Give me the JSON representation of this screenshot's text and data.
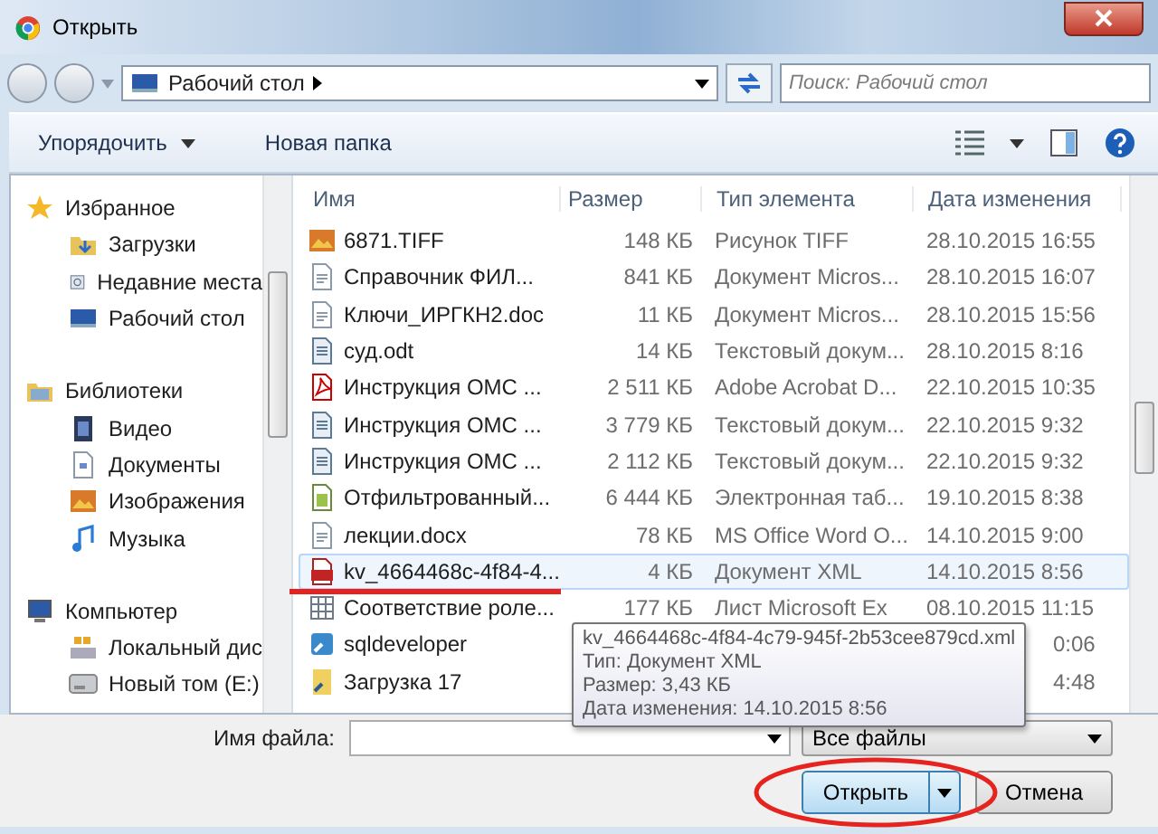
{
  "window": {
    "title": "Открыть"
  },
  "address": {
    "path": "Рабочий стол",
    "search_placeholder": "Поиск: Рабочий стол"
  },
  "toolbar": {
    "organize": "Упорядочить",
    "new_folder": "Новая папка"
  },
  "sidebar": {
    "groups": [
      {
        "label": "Избранное",
        "kind": "star",
        "children": [
          {
            "label": "Загрузки",
            "kind": "download"
          },
          {
            "label": "Недавние места",
            "kind": "recent"
          },
          {
            "label": "Рабочий стол",
            "kind": "desktop"
          }
        ]
      },
      {
        "label": "Библиотеки",
        "kind": "library",
        "children": [
          {
            "label": "Видео",
            "kind": "video"
          },
          {
            "label": "Документы",
            "kind": "document"
          },
          {
            "label": "Изображения",
            "kind": "image"
          },
          {
            "label": "Музыка",
            "kind": "music"
          }
        ]
      },
      {
        "label": "Компьютер",
        "kind": "computer",
        "children": [
          {
            "label": "Локальный дис",
            "kind": "disk"
          },
          {
            "label": "Новый том (E:)",
            "kind": "drive"
          }
        ]
      }
    ]
  },
  "table": {
    "columns": [
      "Имя",
      "Размер",
      "Тип элемента",
      "Дата изменения"
    ],
    "rows": [
      {
        "kind": "image",
        "name": "6871.TIFF",
        "size": "148 КБ",
        "type": "Рисунок TIFF",
        "date": "28.10.2015 16:55",
        "selected": false
      },
      {
        "kind": "doc",
        "name": "Справочник ФИЛ...",
        "size": "841 КБ",
        "type": "Документ Micros...",
        "date": "28.10.2015 16:07",
        "selected": false
      },
      {
        "kind": "doc",
        "name": "Ключи_ИРГКН2.doc",
        "size": "11 КБ",
        "type": "Документ Micros...",
        "date": "28.10.2015 15:56",
        "selected": false
      },
      {
        "kind": "odt",
        "name": "суд.odt",
        "size": "14 КБ",
        "type": "Текстовый докум...",
        "date": "28.10.2015 8:16",
        "selected": false
      },
      {
        "kind": "pdf",
        "name": "Инструкция ОМС ...",
        "size": "2 511 КБ",
        "type": "Adobe Acrobat D...",
        "date": "22.10.2015 10:35",
        "selected": false
      },
      {
        "kind": "odt",
        "name": "Инструкция ОМС ...",
        "size": "3 779 КБ",
        "type": "Текстовый докум...",
        "date": "22.10.2015 9:32",
        "selected": false
      },
      {
        "kind": "odt",
        "name": "Инструкция ОМС ...",
        "size": "2 112 КБ",
        "type": "Текстовый докум...",
        "date": "22.10.2015 9:32",
        "selected": false
      },
      {
        "kind": "sheet",
        "name": "Отфильтрованный...",
        "size": "6 444 КБ",
        "type": "Электронная таб...",
        "date": "19.10.2015 8:38",
        "selected": false
      },
      {
        "kind": "doc",
        "name": "лекции.docx",
        "size": "78 КБ",
        "type": "MS Office Word O...",
        "date": "14.10.2015 9:00",
        "selected": false
      },
      {
        "kind": "xml",
        "name": "kv_4664468c-4f84-4...",
        "size": "4 КБ",
        "type": "Документ XML",
        "date": "14.10.2015 8:56",
        "selected": true
      },
      {
        "kind": "table",
        "name": "Соответствие роле...",
        "size": "177 КБ",
        "type": "Лист Microsoft Ex",
        "date": "08.10.2015 11:15",
        "selected": false
      },
      {
        "kind": "app",
        "name": "sqldeveloper",
        "date": "0:06",
        "selected": false
      },
      {
        "kind": "shortcut",
        "name": "Загрузка 17",
        "date": "4:48",
        "selected": false
      }
    ]
  },
  "tooltip": {
    "lines": [
      "kv_4664468c-4f84-4c79-945f-2b53cee879cd.xml",
      "Тип: Документ XML",
      "Размер: 3,43 КБ",
      "Дата изменения: 14.10.2015 8:56"
    ]
  },
  "footer": {
    "filename_label": "Имя файла:",
    "filter": "Все файлы",
    "open": "Открыть",
    "cancel": "Отмена"
  }
}
